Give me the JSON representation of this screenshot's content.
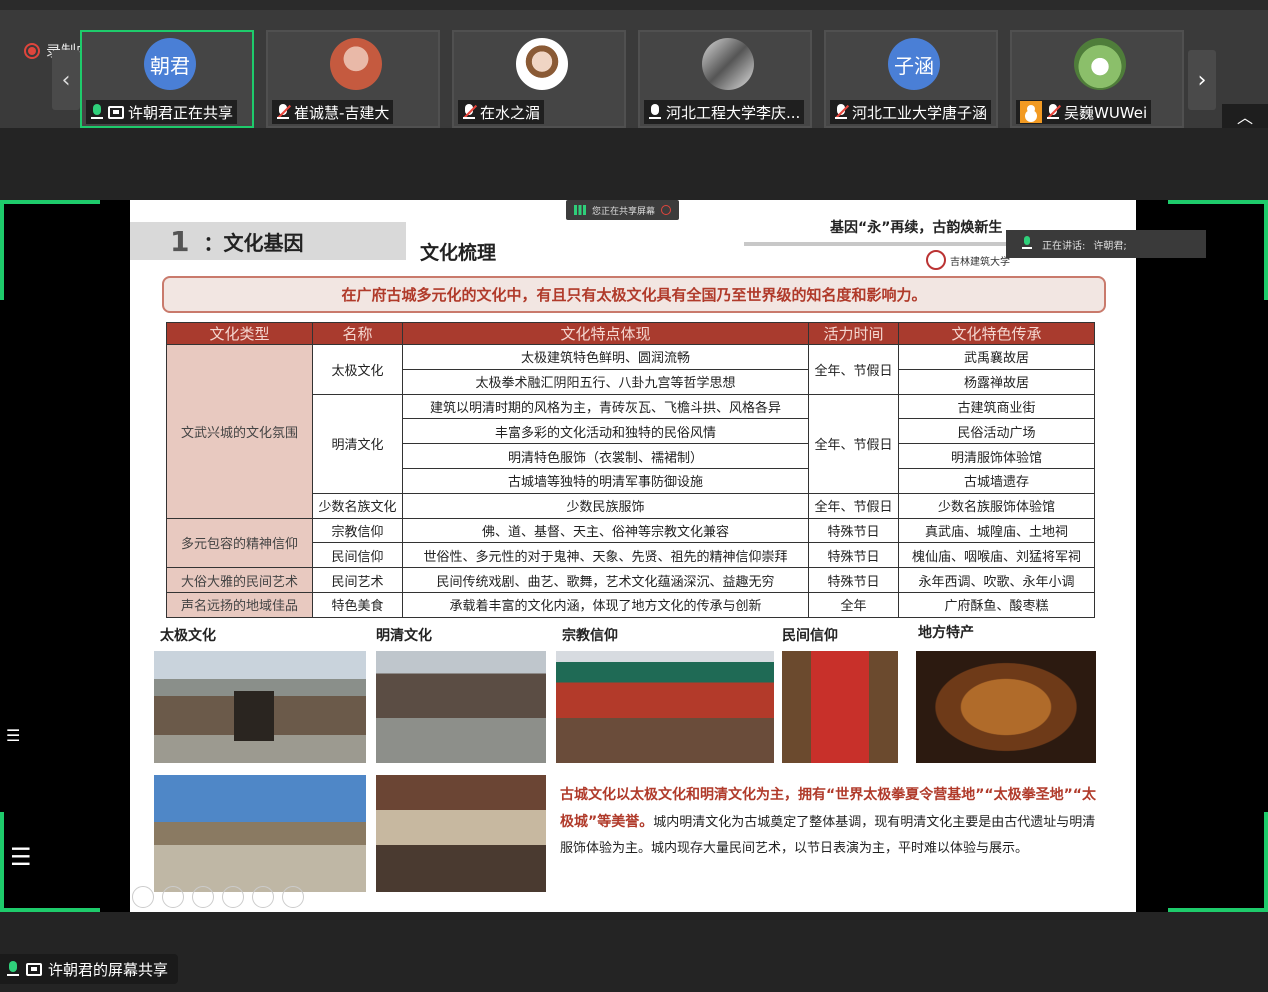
{
  "recording": {
    "label": "录制中"
  },
  "participants": [
    {
      "avatar_text": "朝君",
      "label": "许朝君正在共享",
      "mic": "on",
      "sharing": true,
      "active": true
    },
    {
      "avatar_text": "",
      "label": "崔诚慧-吉建大",
      "mic": "muted"
    },
    {
      "avatar_text": "",
      "label": "在水之湄",
      "mic": "muted"
    },
    {
      "avatar_text": "",
      "label": "河北工程大学李庆...",
      "mic": "unmuted"
    },
    {
      "avatar_text": "子涵",
      "label": "河北工业大学唐子涵",
      "mic": "muted"
    },
    {
      "avatar_text": "",
      "label": "吴巍WUWei",
      "mic": "muted",
      "host": true
    }
  ],
  "share_indicator": {
    "label": "您正在共享屏幕"
  },
  "speaking": {
    "label": "正在讲话:",
    "name": "许朝君;"
  },
  "slide": {
    "section_num": "1",
    "section_title": "：文化基因",
    "subtitle": "文化梳理",
    "slogan": "基因“永”再续，古韵焕新生",
    "university": "吉林建筑大学",
    "banner": "在广府古城多元化的文化中，有且只有太极文化具有全国乃至世界级的知名度和影响力。",
    "table": {
      "headers": [
        "文化类型",
        "名称",
        "文化特点体现",
        "活力时间",
        "文化特色传承"
      ],
      "groups": [
        {
          "type": "文武兴城的文化氛围",
          "items": [
            {
              "name": "太极文化",
              "rows": [
                {
                  "feature": "太极建筑特色鲜明、圆润流畅",
                  "time": "全年、节假日",
                  "heritage": "武禹襄故居"
                },
                {
                  "feature": "太极拳术融汇阴阳五行、八卦九宫等哲学思想",
                  "heritage": "杨露禅故居"
                }
              ]
            },
            {
              "name": "明清文化",
              "rows": [
                {
                  "feature": "建筑以明清时期的风格为主，青砖灰瓦、飞檐斗拱、风格各异",
                  "time": "全年、节假日",
                  "heritage": "古建筑商业街"
                },
                {
                  "feature": "丰富多彩的文化活动和独特的民俗风情",
                  "heritage": "民俗活动广场"
                },
                {
                  "feature": "明清特色服饰（衣裳制、襦裙制）",
                  "heritage": "明清服饰体验馆"
                },
                {
                  "feature": "古城墙等独特的明清军事防御设施",
                  "heritage": "古城墙遗存"
                }
              ]
            },
            {
              "name": "少数名族文化",
              "rows": [
                {
                  "feature": "少数民族服饰",
                  "time": "全年、节假日",
                  "heritage": "少数名族服饰体验馆"
                }
              ]
            }
          ]
        },
        {
          "type": "多元包容的精神信仰",
          "items": [
            {
              "name": "宗教信仰",
              "rows": [
                {
                  "feature": "佛、道、基督、天主、俗神等宗教文化兼容",
                  "time": "特殊节日",
                  "heritage": "真武庙、城隍庙、土地祠"
                }
              ]
            },
            {
              "name": "民间信仰",
              "rows": [
                {
                  "feature": "世俗性、多元性的对于鬼神、天象、先贤、祖先的精神信仰崇拜",
                  "time": "特殊节日",
                  "heritage": "槐仙庙、咽喉庙、刘猛将军祠"
                }
              ]
            }
          ]
        },
        {
          "type": "大俗大雅的民间艺术",
          "items": [
            {
              "name": "民间艺术",
              "rows": [
                {
                  "feature": "民间传统戏剧、曲艺、歌舞，艺术文化蕴涵深沉、益趣无穷",
                  "time": "特殊节日",
                  "heritage": "永年西调、吹歌、永年小调"
                }
              ]
            }
          ]
        },
        {
          "type": "声名远扬的地域佳品",
          "items": [
            {
              "name": "特色美食",
              "rows": [
                {
                  "feature": "承载着丰富的文化内涵，体现了地方文化的传承与创新",
                  "time": "全年",
                  "heritage": "广府酥鱼、酸枣糕"
                }
              ]
            }
          ]
        }
      ]
    },
    "photo_captions": [
      "太极文化",
      "明清文化",
      "宗教信仰",
      "民间信仰",
      "地方特产"
    ],
    "para_bold": "古城文化以太极文化和明清文化为主，拥有“世界太极拳夏令营基地”“太极拳圣地”“太极城”等美誉。",
    "para_text": "城内明清文化为古城奠定了整体基调，现有明清文化主要是由古代遗址与明清服饰体验为主。城内现存大量民间艺术，以节日表演为主，平时难以体验与展示。"
  },
  "bottom": {
    "label": "许朝君的屏幕共享"
  }
}
